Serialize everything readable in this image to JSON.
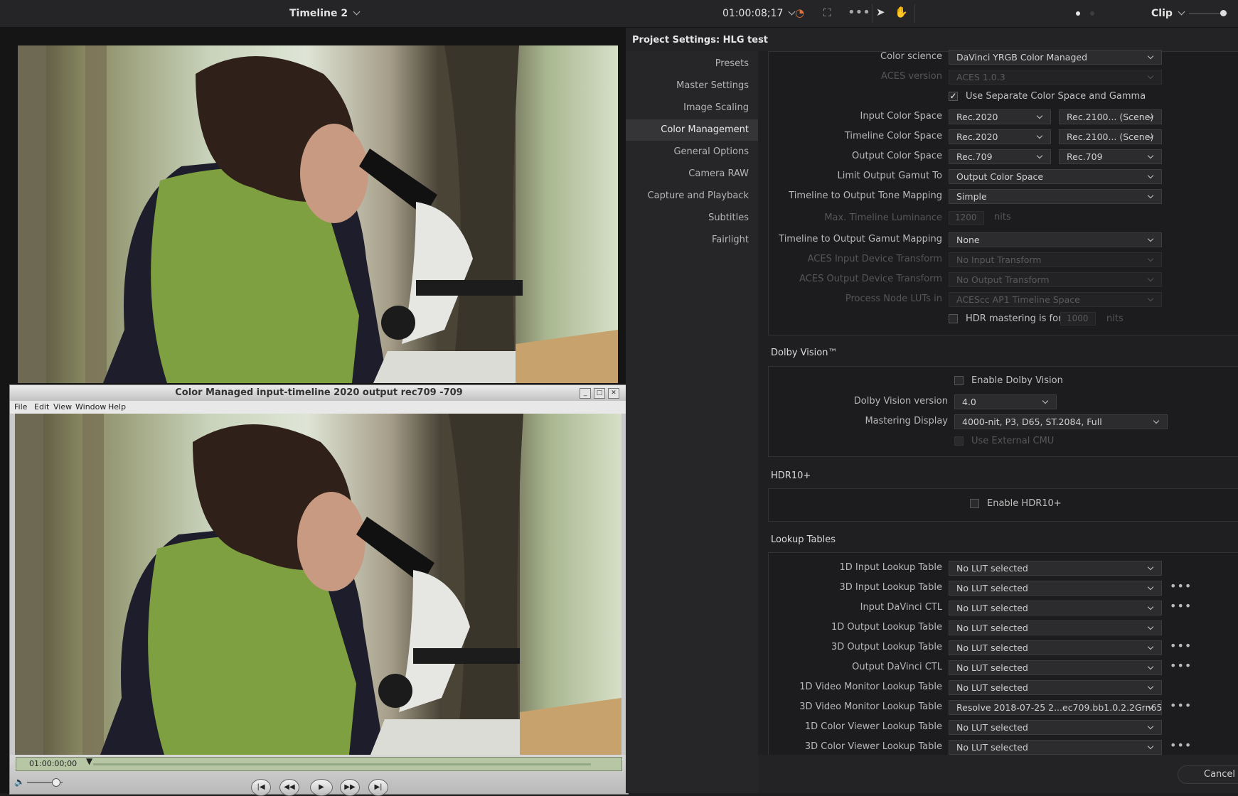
{
  "topbar": {
    "timeline_title": "Timeline 2",
    "timecode": "01:00:08;17",
    "mode_label": "Clip"
  },
  "qt_window": {
    "title": "Color Managed input-timeline 2020 output rec709 -709",
    "menu": [
      "File",
      "Edit",
      "View",
      "Window",
      "Help"
    ],
    "timecode": "01:00:00;00"
  },
  "settings": {
    "title": "Project Settings:  HLG test",
    "nav": [
      "Presets",
      "Master Settings",
      "Image Scaling",
      "Color Management",
      "General Options",
      "Camera RAW",
      "Capture and Playback",
      "Subtitles",
      "Fairlight"
    ],
    "active_nav": "Color Management",
    "color": {
      "color_science_label": "Color science",
      "color_science": "DaVinci YRGB Color Managed",
      "aces_version_label": "ACES version",
      "aces_version": "ACES 1.0.3",
      "separate_label": "Use Separate Color Space and Gamma",
      "input_cs_label": "Input Color Space",
      "input_cs": "Rec.2020",
      "input_gamma": "Rec.2100... (Scene)",
      "timeline_cs_label": "Timeline Color Space",
      "timeline_cs": "Rec.2020",
      "timeline_gamma": "Rec.2100... (Scene)",
      "output_cs_label": "Output Color Space",
      "output_cs": "Rec.709",
      "output_gamma": "Rec.709",
      "limit_gamut_label": "Limit Output Gamut To",
      "limit_gamut": "Output Color Space",
      "tone_mapping_label": "Timeline to Output Tone Mapping",
      "tone_mapping": "Simple",
      "max_lum_label": "Max. Timeline Luminance",
      "max_lum": "1200",
      "nits": "nits",
      "gamut_mapping_label": "Timeline to Output Gamut Mapping",
      "gamut_mapping": "None",
      "aces_idt_label": "ACES Input Device Transform",
      "aces_idt": "No Input Transform",
      "aces_odt_label": "ACES Output Device Transform",
      "aces_odt": "No Output Transform",
      "node_luts_label": "Process Node LUTs in",
      "node_luts": "ACEScc AP1 Timeline Space",
      "hdr_mastering_label": "HDR mastering is for",
      "hdr_mastering": "1000"
    },
    "dolby": {
      "header": "Dolby Vision™",
      "enable_label": "Enable Dolby Vision",
      "version_label": "Dolby Vision version",
      "version": "4.0",
      "mastering_label": "Mastering Display",
      "mastering": "4000-nit, P3, D65, ST.2084, Full",
      "external_cmu_label": "Use External CMU"
    },
    "hdr10": {
      "header": "HDR10+",
      "enable_label": "Enable HDR10+"
    },
    "luts": {
      "header": "Lookup Tables",
      "rows": [
        {
          "label": "1D Input Lookup Table",
          "value": "No LUT selected"
        },
        {
          "label": "3D Input Lookup Table",
          "value": "No LUT selected"
        },
        {
          "label": "Input DaVinci CTL",
          "value": "No LUT selected"
        },
        {
          "label": "1D Output Lookup Table",
          "value": "No LUT selected"
        },
        {
          "label": "3D Output Lookup Table",
          "value": "No LUT selected"
        },
        {
          "label": "Output DaVinci CTL",
          "value": "No LUT selected"
        },
        {
          "label": "1D Video Monitor Lookup Table",
          "value": "No LUT selected"
        },
        {
          "label": "3D Video Monitor Lookup Table",
          "value": "Resolve 2018-07-25 2...ec709.bb1.0.2.2Grn65"
        },
        {
          "label": "1D Color Viewer Lookup Table",
          "value": "No LUT selected"
        },
        {
          "label": "3D Color Viewer Lookup Table",
          "value": "No LUT selected"
        }
      ]
    },
    "cancel_label": "Cancel"
  }
}
